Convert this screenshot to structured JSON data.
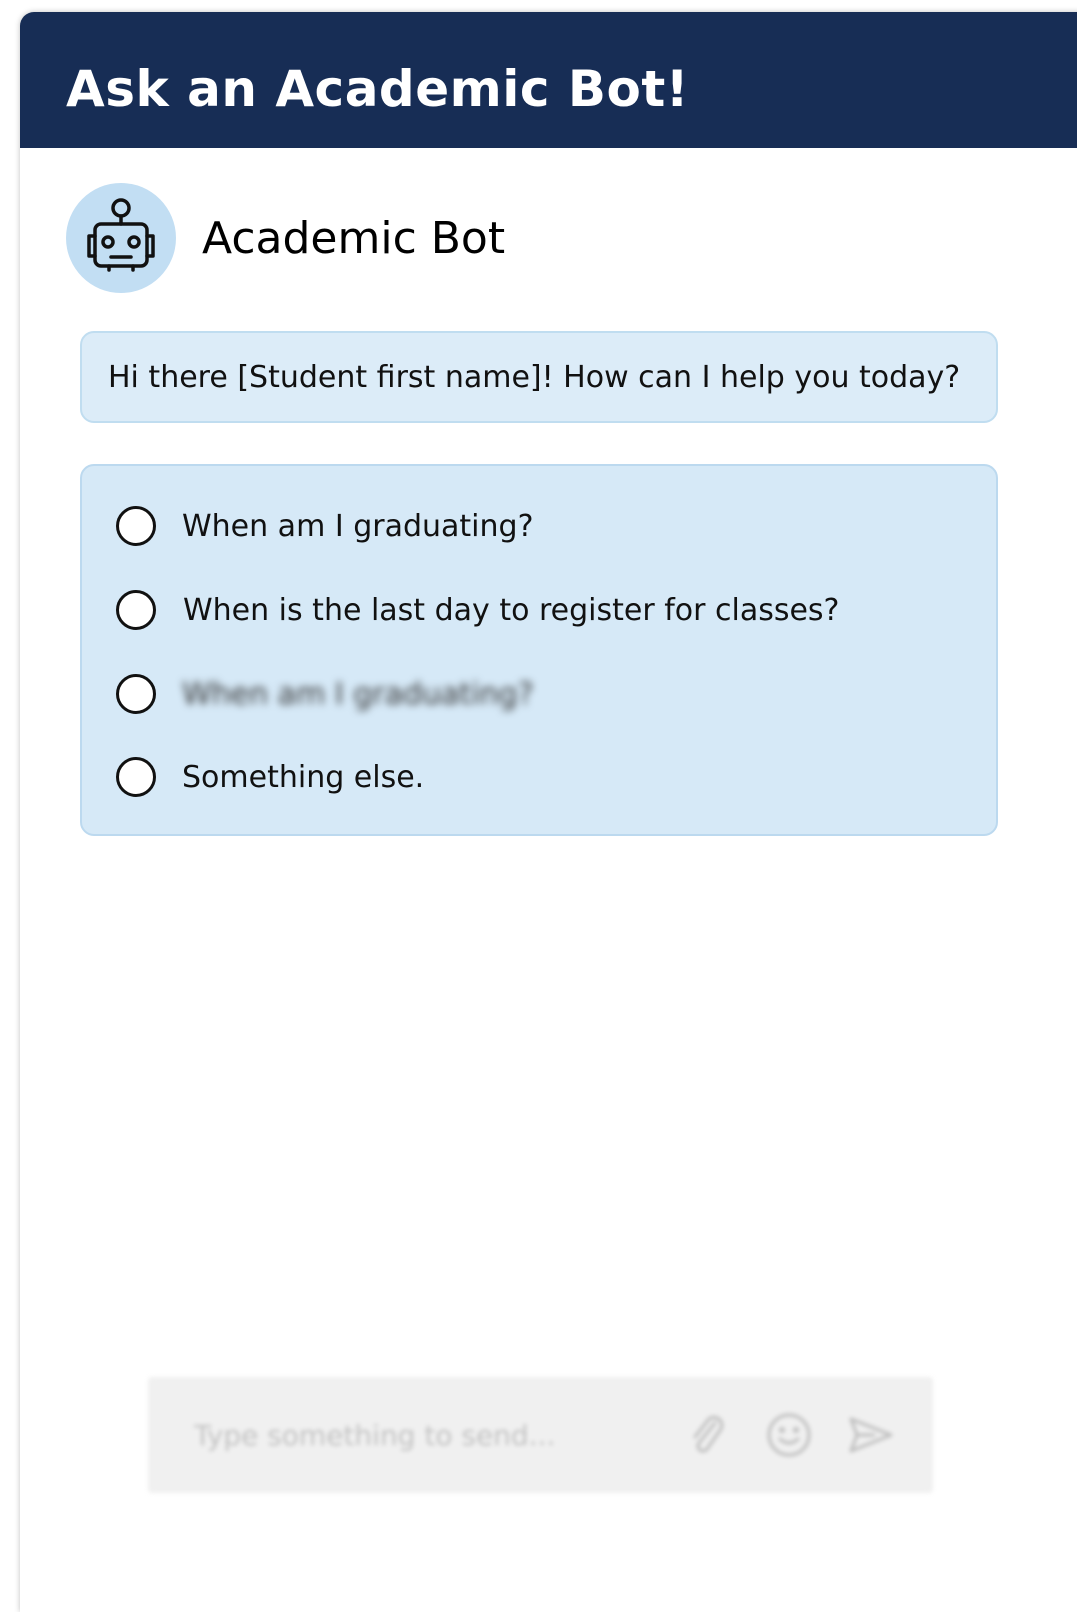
{
  "header": {
    "title": "Ask an Academic Bot!"
  },
  "bot": {
    "name": "Academic Bot",
    "avatar_icon": "robot-icon"
  },
  "messages": {
    "greeting": "Hi there [Student first name]! How can I help you today?"
  },
  "options": [
    {
      "label": "When am I graduating?",
      "selected": false
    },
    {
      "label": "When is the last day to register for classes?",
      "selected": false
    },
    {
      "label": "When am I graduating?",
      "selected": false,
      "blurred": true
    },
    {
      "label": "Something else.",
      "selected": false
    }
  ],
  "composer": {
    "placeholder": "Type something to send...",
    "icons": [
      "paperclip-icon",
      "emoji-icon",
      "send-icon"
    ]
  },
  "colors": {
    "header_bg": "#172d55",
    "avatar_bg": "#c2def3",
    "bubble_bg": "#dcecf8",
    "options_bg": "#d6e9f7"
  }
}
